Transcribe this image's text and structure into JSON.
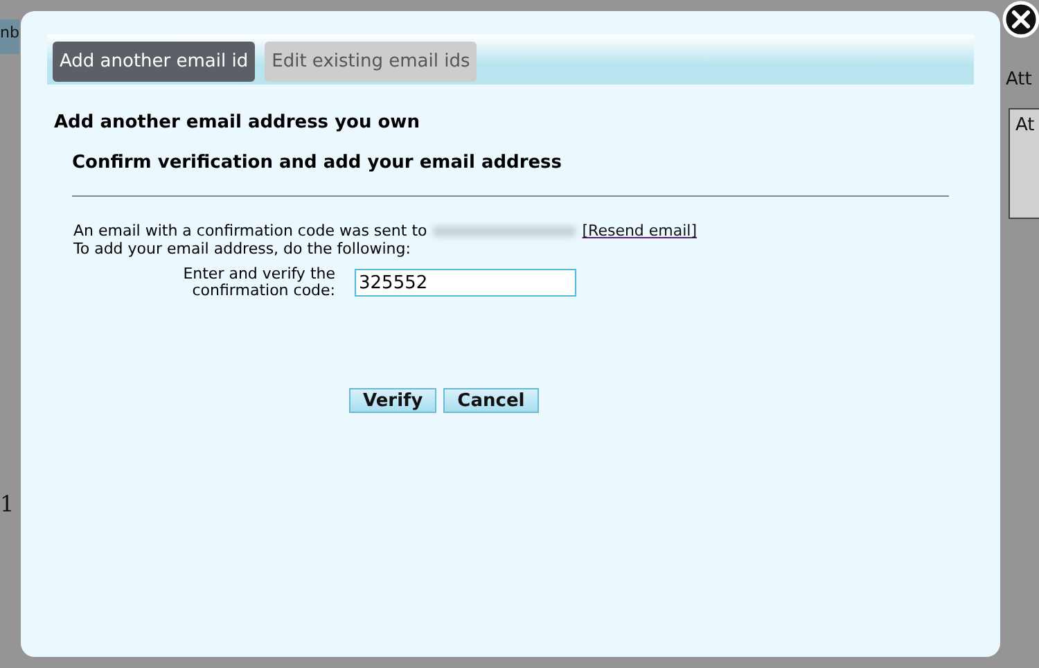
{
  "background_page": {
    "fragments": [
      {
        "kind": "tab",
        "text": "nb"
      },
      {
        "kind": "label",
        "text": "Att"
      },
      {
        "kind": "box",
        "text": "At"
      },
      {
        "kind": "plain",
        "text": "1"
      }
    ]
  },
  "dialog": {
    "tabs": [
      {
        "label": "Add another email id",
        "selected": true
      },
      {
        "label": "Edit existing email ids",
        "selected": false
      }
    ],
    "heading": "Add another email address you own",
    "subheading": "Confirm verification and add your email address",
    "message_prefix": "An email with a confirmation code was sent to",
    "email_redacted": true,
    "resend_link": "[Resend email]",
    "instruction": "To add your email address, do the following:",
    "code_label": "Enter and verify the confirmation code:",
    "code_value": "325552",
    "buttons": [
      "Verify",
      "Cancel"
    ]
  }
}
